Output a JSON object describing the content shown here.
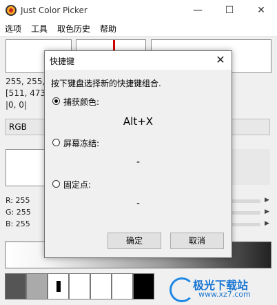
{
  "app": {
    "title": "Just Color Picker"
  },
  "window_controls": {
    "minimize": "—",
    "maximize": "☐",
    "close": "✕"
  },
  "menu": [
    "选项",
    "工具",
    "取色历史",
    "帮助"
  ],
  "info": {
    "rgb_values": "255, 255, 2",
    "coordinates": "[511, 473]",
    "offset": "|0, 0|"
  },
  "format_select": {
    "value": "RGB"
  },
  "channels": [
    {
      "label": "R: 255"
    },
    {
      "label": "G: 255"
    },
    {
      "label": "B: 255"
    }
  ],
  "history_swatch_colors": [
    "#555555",
    "#aaaaaa",
    "#ffffff",
    "#ffffff",
    "#ffffff",
    "#ffffff",
    "#000000"
  ],
  "dialog": {
    "title": "快捷键",
    "close_icon": "✕",
    "instruction": "按下键盘选择新的快捷键组合.",
    "options": [
      {
        "label": "捕获颜色:",
        "shortcut": "Alt+X",
        "checked": true
      },
      {
        "label": "屏幕冻结:",
        "shortcut": "-",
        "checked": false
      },
      {
        "label": "固定点:",
        "shortcut": "-",
        "checked": false
      }
    ],
    "ok_label": "确定",
    "cancel_label": "取消"
  },
  "watermark": {
    "text": "极光下载站",
    "url": "www.xz7.com"
  }
}
